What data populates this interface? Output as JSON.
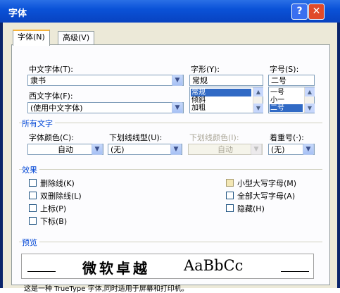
{
  "window": {
    "title": "字体"
  },
  "tabs": [
    {
      "label": "字体(N)"
    },
    {
      "label": "高级(V)"
    }
  ],
  "fields": {
    "cn_font_label": "中文字体(T):",
    "cn_font_value": "隶书",
    "west_font_label": "西文字体(F):",
    "west_font_value": "(使用中文字体)",
    "style_label": "字形(Y):",
    "style_value": "常规",
    "style_options": [
      "常规",
      "倾斜",
      "加粗"
    ],
    "size_label": "字号(S):",
    "size_value": "二号",
    "size_options": [
      "一号",
      "小一",
      "二号"
    ]
  },
  "all_text": {
    "group_label": "所有文字",
    "font_color_label": "字体颜色(C):",
    "font_color_value": "自动",
    "underline_type_label": "下划线线型(U):",
    "underline_type_value": "(无)",
    "underline_color_label": "下划线颜色(I):",
    "underline_color_value": "自动",
    "emphasis_label": "着重号(·):",
    "emphasis_value": "(无)"
  },
  "effects": {
    "group_label": "效果",
    "left": [
      "删除线(K)",
      "双删除线(L)",
      "上标(P)",
      "下标(B)"
    ],
    "right": [
      "小型大写字母(M)",
      "全部大写字母(A)",
      "隐藏(H)"
    ]
  },
  "preview": {
    "group_label": "预览",
    "sample_cjk": "微软卓越",
    "sample_latin": "AaBbCc",
    "description": "这是一种 TrueType 字体,同时适用于屏幕和打印机。"
  }
}
